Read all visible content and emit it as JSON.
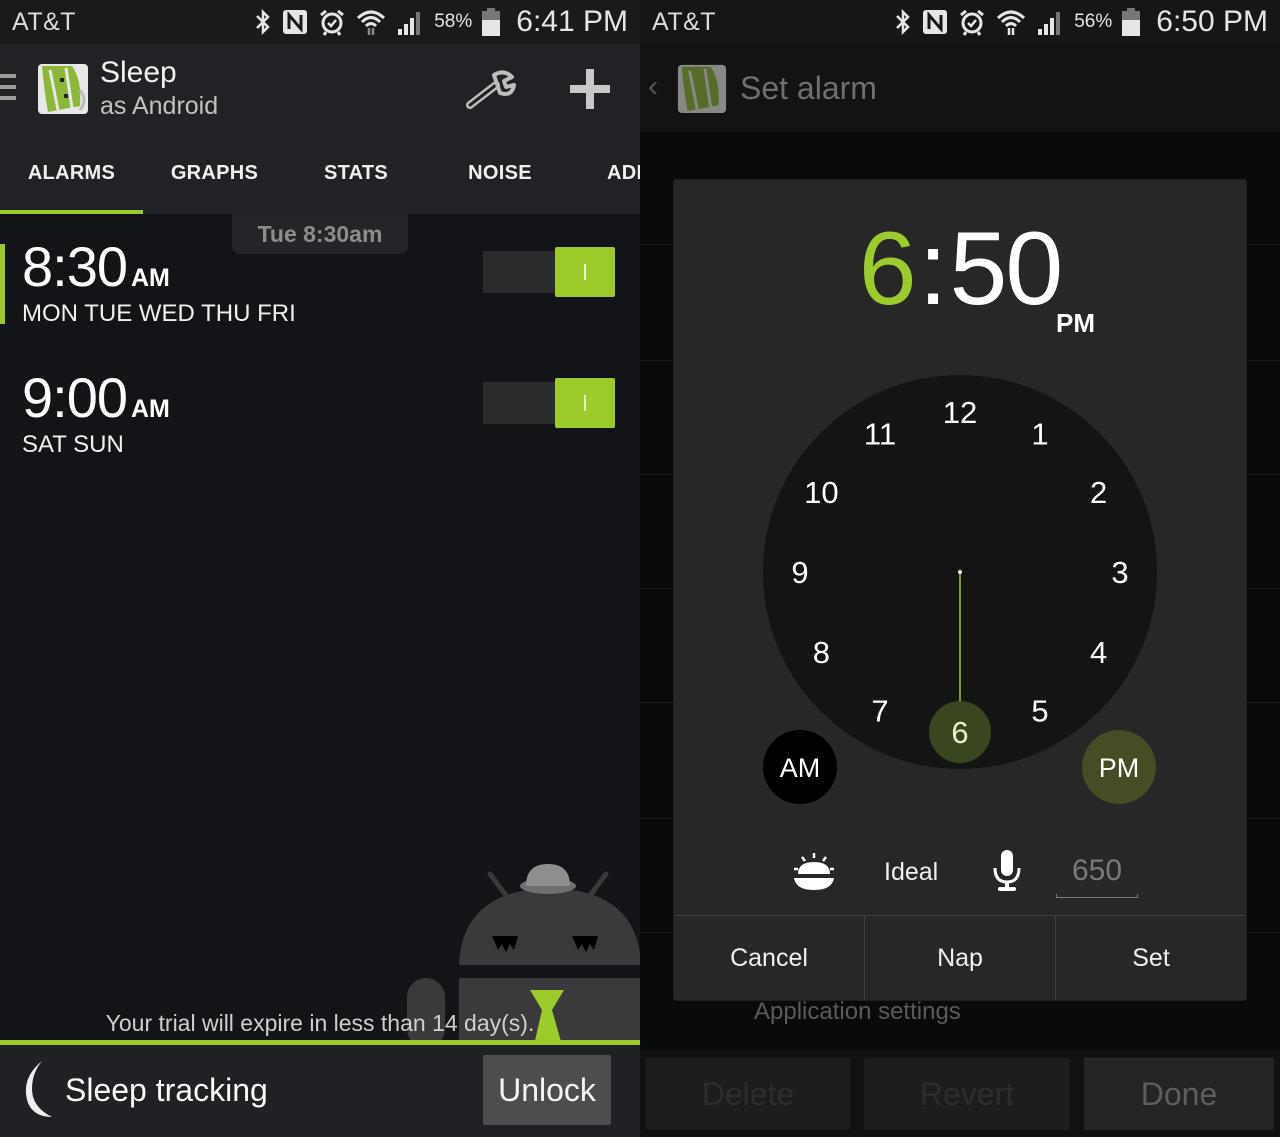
{
  "left_screen": {
    "status_bar": {
      "carrier": "AT&T",
      "icons": [
        "bluetooth-icon",
        "nfc-icon",
        "alarm-clock-icon",
        "wifi-icon",
        "signal-icon",
        "battery-icon"
      ],
      "battery_percent": "58%",
      "time": "6:41 PM"
    },
    "app_bar": {
      "title": "Sleep",
      "subtitle": "as Android",
      "actions": [
        "settings-wrench-icon",
        "add-plus-icon"
      ]
    },
    "tabs": [
      {
        "label": "ALARMS",
        "active": true
      },
      {
        "label": "GRAPHS",
        "active": false
      },
      {
        "label": "STATS",
        "active": false
      },
      {
        "label": "NOISE",
        "active": false
      },
      {
        "label": "ADD",
        "active": false
      }
    ],
    "next_alarm": "Tue 8:30am",
    "alarms": [
      {
        "time": "8:30",
        "ampm": "AM",
        "days": "MON TUE WED THU FRI",
        "enabled": true,
        "highlighted": true
      },
      {
        "time": "9:00",
        "ampm": "AM",
        "days": "SAT SUN",
        "enabled": true,
        "highlighted": false
      }
    ],
    "trial_notice": "Your trial will expire in less than 14 day(s).",
    "bottom_bar": {
      "label": "Sleep tracking",
      "button": "Unlock"
    }
  },
  "right_screen": {
    "status_bar": {
      "carrier": "AT&T",
      "icons": [
        "bluetooth-icon",
        "nfc-icon",
        "alarm-clock-icon",
        "wifi-icon",
        "signal-icon",
        "battery-icon"
      ],
      "battery_percent": "56%",
      "time": "6:50 PM"
    },
    "app_bar": {
      "title": "Set alarm"
    },
    "background": {
      "app_settings_label": "Application settings",
      "buttons": [
        "Delete",
        "Revert",
        "Done"
      ]
    },
    "time_picker": {
      "hour": "6",
      "separator": ":",
      "minute": "50",
      "ampm": "PM",
      "dial_numbers": [
        "12",
        "1",
        "2",
        "3",
        "4",
        "5",
        "6",
        "7",
        "8",
        "9",
        "10",
        "11"
      ],
      "selected_hour": "6",
      "am_label": "AM",
      "pm_label": "PM",
      "selected_period": "PM",
      "smart_wakeup_label": "Ideal",
      "snooze_value": "650",
      "buttons": {
        "cancel": "Cancel",
        "nap": "Nap",
        "set": "Set"
      }
    }
  },
  "colors": {
    "accent": "#9ccc2c",
    "dialog_bg": "#272727",
    "dial_bg": "#141414",
    "selected_bubble": "#3a4620",
    "pm_bubble": "#444d24"
  }
}
